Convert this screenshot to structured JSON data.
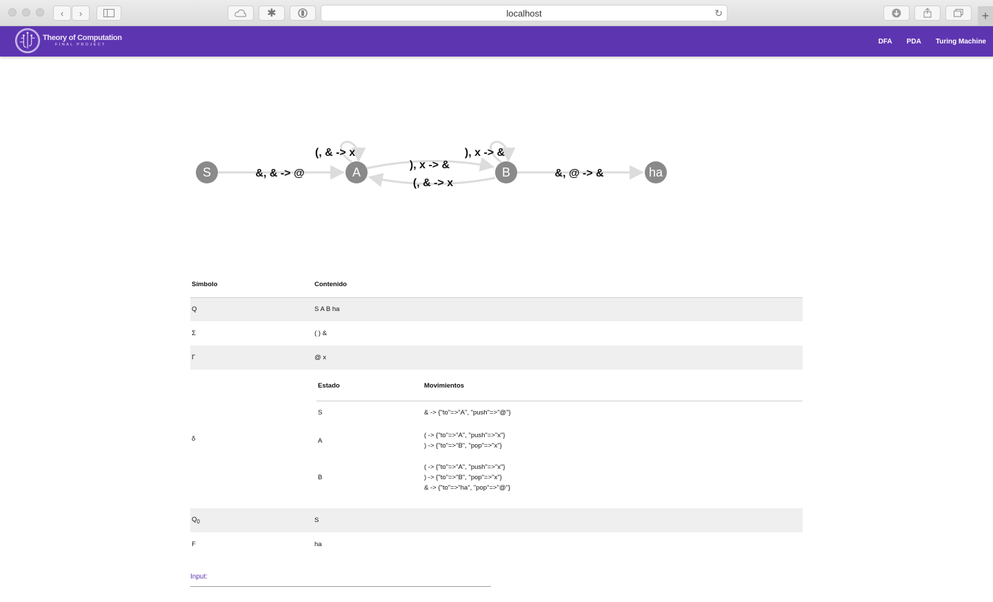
{
  "browser": {
    "url": "localhost",
    "new_tab_label": "+"
  },
  "navbar": {
    "logo_title": "Theory of Computation",
    "logo_subtitle": "FINAL PROJECT",
    "links": [
      "DFA",
      "PDA",
      "Turing Machine"
    ]
  },
  "graph": {
    "states": [
      "S",
      "A",
      "B",
      "ha"
    ],
    "edges": [
      {
        "from": "S",
        "to": "A",
        "label": "&, & -> @"
      },
      {
        "from": "A",
        "to": "A",
        "label": "(, & -> x"
      },
      {
        "from": "A",
        "to": "B",
        "label": "), x -> &"
      },
      {
        "from": "B",
        "to": "A",
        "label": "(, & -> x"
      },
      {
        "from": "B",
        "to": "B",
        "label": "), x -> &"
      },
      {
        "from": "B",
        "to": "ha",
        "label": "&, @ -> &"
      }
    ]
  },
  "table": {
    "headers": [
      "Símbolo",
      "Contenido"
    ],
    "rows": [
      {
        "symbol": "Q",
        "content": "S A B ha"
      },
      {
        "symbol": "Σ",
        "content": "( ) &"
      },
      {
        "symbol": "Γ",
        "content": "@ x"
      }
    ],
    "delta": {
      "symbol": "δ",
      "headers": [
        "Estado",
        "Movimientos"
      ],
      "rows": [
        {
          "state": "S",
          "moves": [
            "& -> {\"to\"=>\"A\", \"push\"=>\"@\"}"
          ]
        },
        {
          "state": "A",
          "moves": [
            "( -> {\"to\"=>\"A\", \"push\"=>\"x\"}",
            ") -> {\"to\"=>\"B\", \"pop\"=>\"x\"}"
          ]
        },
        {
          "state": "B",
          "moves": [
            "( -> {\"to\"=>\"A\", \"push\"=>\"x\"}",
            ") -> {\"to\"=>\"B\", \"pop\"=>\"x\"}",
            "& -> {\"to\"=>\"ha\", \"pop\"=>\"@\"}"
          ]
        }
      ]
    },
    "q0": {
      "symbol": "Q",
      "sub": "0",
      "content": "S"
    },
    "final": {
      "symbol": "F",
      "content": "ha"
    }
  },
  "input": {
    "label": "Input:",
    "value": ""
  },
  "colors": {
    "brand": "#5e35b1",
    "state_fill": "#8a8a8a",
    "edge": "#dcdcdc"
  }
}
